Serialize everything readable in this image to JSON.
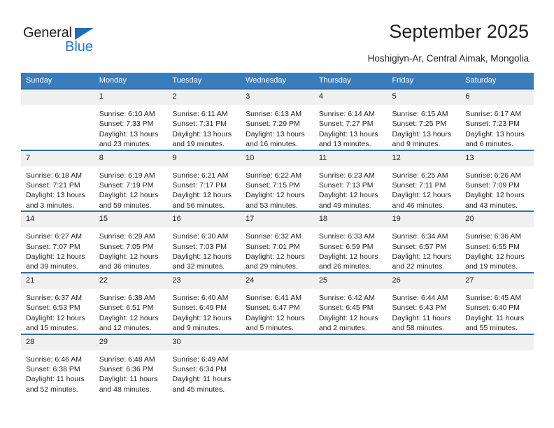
{
  "brand": {
    "name_dark": "General",
    "name_blue": "Blue",
    "accent_color": "#2279c4",
    "triangle_color": "#1f6db5"
  },
  "header": {
    "title": "September 2025",
    "subtitle": "Hoshigiyn-Ar, Central Aimak, Mongolia"
  },
  "theme": {
    "header_row_bg": "#3a7dba",
    "row_border": "#2e6da4",
    "daynum_bg": "#f0f0f0",
    "text": "#231f20"
  },
  "weekday_headers": [
    "Sunday",
    "Monday",
    "Tuesday",
    "Wednesday",
    "Thursday",
    "Friday",
    "Saturday"
  ],
  "weeks": [
    {
      "days": [
        {
          "num": "",
          "empty": true,
          "sunrise": "",
          "sunset": "",
          "daylight_line1": "",
          "daylight_line2": ""
        },
        {
          "num": "1",
          "empty": false,
          "sunrise": "Sunrise: 6:10 AM",
          "sunset": "Sunset: 7:33 PM",
          "daylight_line1": "Daylight: 13 hours",
          "daylight_line2": "and 23 minutes."
        },
        {
          "num": "2",
          "empty": false,
          "sunrise": "Sunrise: 6:11 AM",
          "sunset": "Sunset: 7:31 PM",
          "daylight_line1": "Daylight: 13 hours",
          "daylight_line2": "and 19 minutes."
        },
        {
          "num": "3",
          "empty": false,
          "sunrise": "Sunrise: 6:13 AM",
          "sunset": "Sunset: 7:29 PM",
          "daylight_line1": "Daylight: 13 hours",
          "daylight_line2": "and 16 minutes."
        },
        {
          "num": "4",
          "empty": false,
          "sunrise": "Sunrise: 6:14 AM",
          "sunset": "Sunset: 7:27 PM",
          "daylight_line1": "Daylight: 13 hours",
          "daylight_line2": "and 13 minutes."
        },
        {
          "num": "5",
          "empty": false,
          "sunrise": "Sunrise: 6:15 AM",
          "sunset": "Sunset: 7:25 PM",
          "daylight_line1": "Daylight: 13 hours",
          "daylight_line2": "and 9 minutes."
        },
        {
          "num": "6",
          "empty": false,
          "sunrise": "Sunrise: 6:17 AM",
          "sunset": "Sunset: 7:23 PM",
          "daylight_line1": "Daylight: 13 hours",
          "daylight_line2": "and 6 minutes."
        }
      ]
    },
    {
      "days": [
        {
          "num": "7",
          "empty": false,
          "sunrise": "Sunrise: 6:18 AM",
          "sunset": "Sunset: 7:21 PM",
          "daylight_line1": "Daylight: 13 hours",
          "daylight_line2": "and 3 minutes."
        },
        {
          "num": "8",
          "empty": false,
          "sunrise": "Sunrise: 6:19 AM",
          "sunset": "Sunset: 7:19 PM",
          "daylight_line1": "Daylight: 12 hours",
          "daylight_line2": "and 59 minutes."
        },
        {
          "num": "9",
          "empty": false,
          "sunrise": "Sunrise: 6:21 AM",
          "sunset": "Sunset: 7:17 PM",
          "daylight_line1": "Daylight: 12 hours",
          "daylight_line2": "and 56 minutes."
        },
        {
          "num": "10",
          "empty": false,
          "sunrise": "Sunrise: 6:22 AM",
          "sunset": "Sunset: 7:15 PM",
          "daylight_line1": "Daylight: 12 hours",
          "daylight_line2": "and 53 minutes."
        },
        {
          "num": "11",
          "empty": false,
          "sunrise": "Sunrise: 6:23 AM",
          "sunset": "Sunset: 7:13 PM",
          "daylight_line1": "Daylight: 12 hours",
          "daylight_line2": "and 49 minutes."
        },
        {
          "num": "12",
          "empty": false,
          "sunrise": "Sunrise: 6:25 AM",
          "sunset": "Sunset: 7:11 PM",
          "daylight_line1": "Daylight: 12 hours",
          "daylight_line2": "and 46 minutes."
        },
        {
          "num": "13",
          "empty": false,
          "sunrise": "Sunrise: 6:26 AM",
          "sunset": "Sunset: 7:09 PM",
          "daylight_line1": "Daylight: 12 hours",
          "daylight_line2": "and 43 minutes."
        }
      ]
    },
    {
      "days": [
        {
          "num": "14",
          "empty": false,
          "sunrise": "Sunrise: 6:27 AM",
          "sunset": "Sunset: 7:07 PM",
          "daylight_line1": "Daylight: 12 hours",
          "daylight_line2": "and 39 minutes."
        },
        {
          "num": "15",
          "empty": false,
          "sunrise": "Sunrise: 6:29 AM",
          "sunset": "Sunset: 7:05 PM",
          "daylight_line1": "Daylight: 12 hours",
          "daylight_line2": "and 36 minutes."
        },
        {
          "num": "16",
          "empty": false,
          "sunrise": "Sunrise: 6:30 AM",
          "sunset": "Sunset: 7:03 PM",
          "daylight_line1": "Daylight: 12 hours",
          "daylight_line2": "and 32 minutes."
        },
        {
          "num": "17",
          "empty": false,
          "sunrise": "Sunrise: 6:32 AM",
          "sunset": "Sunset: 7:01 PM",
          "daylight_line1": "Daylight: 12 hours",
          "daylight_line2": "and 29 minutes."
        },
        {
          "num": "18",
          "empty": false,
          "sunrise": "Sunrise: 6:33 AM",
          "sunset": "Sunset: 6:59 PM",
          "daylight_line1": "Daylight: 12 hours",
          "daylight_line2": "and 26 minutes."
        },
        {
          "num": "19",
          "empty": false,
          "sunrise": "Sunrise: 6:34 AM",
          "sunset": "Sunset: 6:57 PM",
          "daylight_line1": "Daylight: 12 hours",
          "daylight_line2": "and 22 minutes."
        },
        {
          "num": "20",
          "empty": false,
          "sunrise": "Sunrise: 6:36 AM",
          "sunset": "Sunset: 6:55 PM",
          "daylight_line1": "Daylight: 12 hours",
          "daylight_line2": "and 19 minutes."
        }
      ]
    },
    {
      "days": [
        {
          "num": "21",
          "empty": false,
          "sunrise": "Sunrise: 6:37 AM",
          "sunset": "Sunset: 6:53 PM",
          "daylight_line1": "Daylight: 12 hours",
          "daylight_line2": "and 15 minutes."
        },
        {
          "num": "22",
          "empty": false,
          "sunrise": "Sunrise: 6:38 AM",
          "sunset": "Sunset: 6:51 PM",
          "daylight_line1": "Daylight: 12 hours",
          "daylight_line2": "and 12 minutes."
        },
        {
          "num": "23",
          "empty": false,
          "sunrise": "Sunrise: 6:40 AM",
          "sunset": "Sunset: 6:49 PM",
          "daylight_line1": "Daylight: 12 hours",
          "daylight_line2": "and 9 minutes."
        },
        {
          "num": "24",
          "empty": false,
          "sunrise": "Sunrise: 6:41 AM",
          "sunset": "Sunset: 6:47 PM",
          "daylight_line1": "Daylight: 12 hours",
          "daylight_line2": "and 5 minutes."
        },
        {
          "num": "25",
          "empty": false,
          "sunrise": "Sunrise: 6:42 AM",
          "sunset": "Sunset: 6:45 PM",
          "daylight_line1": "Daylight: 12 hours",
          "daylight_line2": "and 2 minutes."
        },
        {
          "num": "26",
          "empty": false,
          "sunrise": "Sunrise: 6:44 AM",
          "sunset": "Sunset: 6:43 PM",
          "daylight_line1": "Daylight: 11 hours",
          "daylight_line2": "and 58 minutes."
        },
        {
          "num": "27",
          "empty": false,
          "sunrise": "Sunrise: 6:45 AM",
          "sunset": "Sunset: 6:40 PM",
          "daylight_line1": "Daylight: 11 hours",
          "daylight_line2": "and 55 minutes."
        }
      ]
    },
    {
      "days": [
        {
          "num": "28",
          "empty": false,
          "sunrise": "Sunrise: 6:46 AM",
          "sunset": "Sunset: 6:38 PM",
          "daylight_line1": "Daylight: 11 hours",
          "daylight_line2": "and 52 minutes."
        },
        {
          "num": "29",
          "empty": false,
          "sunrise": "Sunrise: 6:48 AM",
          "sunset": "Sunset: 6:36 PM",
          "daylight_line1": "Daylight: 11 hours",
          "daylight_line2": "and 48 minutes."
        },
        {
          "num": "30",
          "empty": false,
          "sunrise": "Sunrise: 6:49 AM",
          "sunset": "Sunset: 6:34 PM",
          "daylight_line1": "Daylight: 11 hours",
          "daylight_line2": "and 45 minutes."
        },
        {
          "num": "",
          "empty": true,
          "sunrise": "",
          "sunset": "",
          "daylight_line1": "",
          "daylight_line2": ""
        },
        {
          "num": "",
          "empty": true,
          "sunrise": "",
          "sunset": "",
          "daylight_line1": "",
          "daylight_line2": ""
        },
        {
          "num": "",
          "empty": true,
          "sunrise": "",
          "sunset": "",
          "daylight_line1": "",
          "daylight_line2": ""
        },
        {
          "num": "",
          "empty": true,
          "sunrise": "",
          "sunset": "",
          "daylight_line1": "",
          "daylight_line2": ""
        }
      ]
    }
  ]
}
